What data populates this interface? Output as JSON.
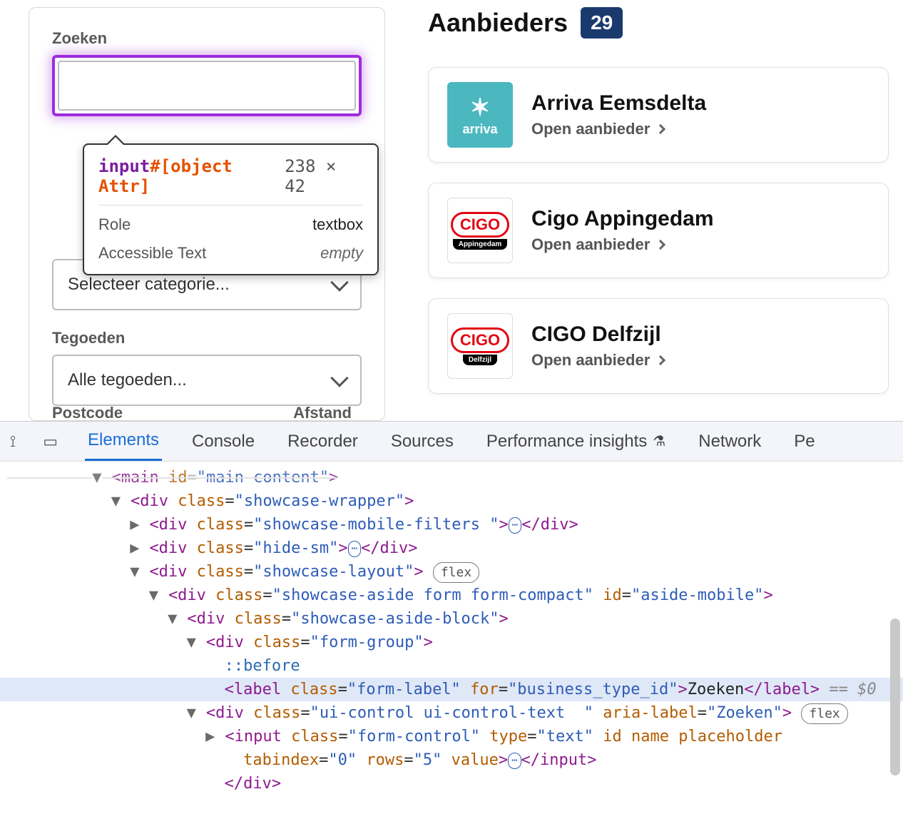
{
  "filters": {
    "search_label": "Zoeken",
    "category_placeholder": "Selecteer categorie...",
    "tegoeden_label": "Tegoeden",
    "tegoeden_placeholder": "Alle tegoeden...",
    "cut_left": "Postcode",
    "cut_right": "Afstand"
  },
  "inspector": {
    "tag": "input",
    "selector": "#[object Attr]",
    "dims": "238 × 42",
    "rows": [
      {
        "label": "Role",
        "value": "textbox",
        "italic": false
      },
      {
        "label": "Accessible Text",
        "value": "empty",
        "italic": true
      }
    ]
  },
  "results": {
    "title": "Aanbieders",
    "count": "29",
    "link_label": "Open aanbieder",
    "items": [
      {
        "name": "Arriva Eemsdelta",
        "logo_type": "arriva",
        "logo_text": "arriva",
        "sub": ""
      },
      {
        "name": "Cigo Appingedam",
        "logo_type": "cigo",
        "logo_text": "CIGO",
        "sub": "Appingedam"
      },
      {
        "name": "CIGO Delfzijl",
        "logo_type": "cigo",
        "logo_text": "CIGO",
        "sub": "Delfzijl"
      }
    ]
  },
  "devtools": {
    "tabs": [
      "Elements",
      "Console",
      "Recorder",
      "Sources",
      "Performance insights",
      "Network",
      "Pe"
    ],
    "active_tab": 0,
    "flex_badge": "flex",
    "dom": {
      "l0": "<main id=\"main-content\">",
      "l1": "<div class=\"showcase-wrapper\">",
      "l2": "<div class=\"showcase-mobile-filters \">",
      "l2e": "</div>",
      "l3": "<div class=\"hide-sm\">",
      "l4": "<div class=\"showcase-layout\">",
      "l5": "<div class=\"showcase-aside form form-compact\" id=\"aside-mobile\">",
      "l6": "<div class=\"showcase-aside-block\">",
      "l7": "<div class=\"form-group\">",
      "l8": "::before",
      "l9": "<label class=\"form-label\" for=\"business_type_id\">Zoeken</label>",
      "l9s": " == $0",
      "l10": "<div class=\"ui-control ui-control-text  \" aria-label=\"Zoeken\">",
      "l11a": "<input class=\"form-control\" type=\"text\" id name placeholder",
      "l11b": "tabindex=\"0\" rows=\"5\" value>",
      "l11e": "</input>",
      "l12": "</div>"
    }
  }
}
